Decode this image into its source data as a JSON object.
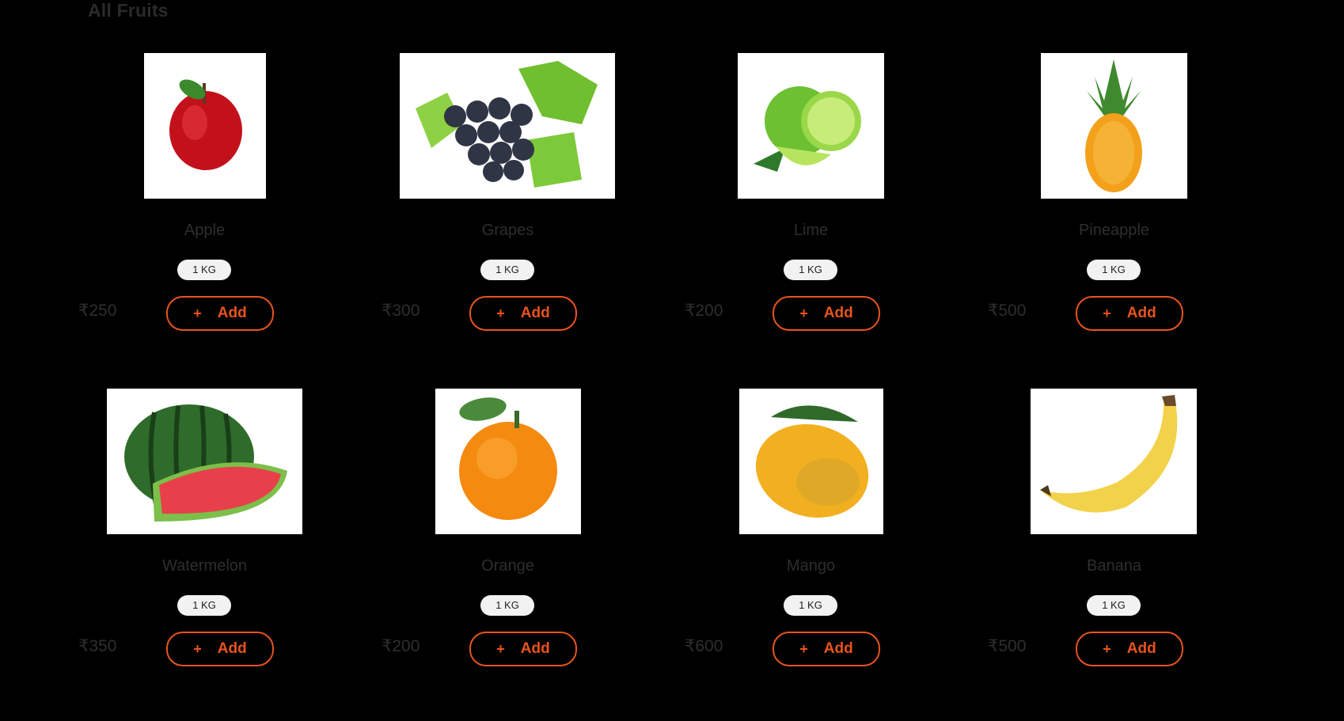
{
  "section": {
    "title": "All Fruits"
  },
  "products": [
    {
      "name": "Apple",
      "weight": "1 KG",
      "price": "₹250",
      "add_label": "Add",
      "add_icon": "+",
      "image": "apple-image"
    },
    {
      "name": "Grapes",
      "weight": "1 KG",
      "price": "₹300",
      "add_label": "Add",
      "add_icon": "+",
      "image": "grapes-image"
    },
    {
      "name": "Lime",
      "weight": "1 KG",
      "price": "₹200",
      "add_label": "Add",
      "add_icon": "+",
      "image": "lime-image"
    },
    {
      "name": "Pineapple",
      "weight": "1 KG",
      "price": "₹500",
      "add_label": "Add",
      "add_icon": "+",
      "image": "pineapple-image"
    },
    {
      "name": "Watermelon",
      "weight": "1 KG",
      "price": "₹350",
      "add_label": "Add",
      "add_icon": "+",
      "image": "watermelon-image"
    },
    {
      "name": "Orange",
      "weight": "1 KG",
      "price": "₹200",
      "add_label": "Add",
      "add_icon": "+",
      "image": "orange-image"
    },
    {
      "name": "Mango",
      "weight": "1 KG",
      "price": "₹600",
      "add_label": "Add",
      "add_icon": "+",
      "image": "mango-image"
    },
    {
      "name": "Banana",
      "weight": "1 KG",
      "price": "₹500",
      "add_label": "Add",
      "add_icon": "+",
      "image": "banana-image"
    }
  ],
  "colors": {
    "accent": "#e8541d",
    "background": "#000000",
    "text_muted": "#2e2e2e"
  }
}
